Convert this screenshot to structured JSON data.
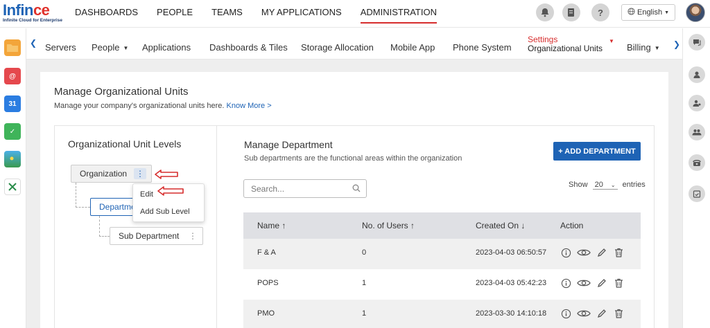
{
  "logo": {
    "brand_main": "Infin",
    "brand_accent": "ce",
    "tagline": "Infinite Cloud for Enterprise"
  },
  "main_nav": [
    "DASHBOARDS",
    "PEOPLE",
    "TEAMS",
    "MY APPLICATIONS",
    "ADMINISTRATION"
  ],
  "main_nav_active": "ADMINISTRATION",
  "header": {
    "language": "English",
    "help_symbol": "?"
  },
  "sub_nav": {
    "items": [
      "Servers",
      "People",
      "Applications",
      "Dashboards & Tiles",
      "Storage Allocation",
      "Mobile App",
      "Phone System"
    ],
    "settings_label": "Settings",
    "settings_value": "Organizational Units",
    "billing": "Billing"
  },
  "calendar_day": "31",
  "page": {
    "title": "Manage Organizational Units",
    "subtitle": "Manage your company's organizational units here.",
    "know_more": "Know More >"
  },
  "levels": {
    "title": "Organizational Unit Levels",
    "nodes": [
      "Organization",
      "Department",
      "Sub Department"
    ],
    "menu": [
      "Edit",
      "Add Sub Level"
    ]
  },
  "departments": {
    "title": "Manage Department",
    "subtitle": "Sub departments are the functional areas within the organization",
    "add_button": "+ ADD DEPARTMENT",
    "search_placeholder": "Search...",
    "show_label": "Show",
    "entries_value": "20",
    "entries_label": "entries",
    "columns": [
      "Name ↑",
      "No. of Users ↑",
      "Created On ↓",
      "Action"
    ],
    "rows": [
      {
        "name": "F & A",
        "users": "0",
        "created": "2023-04-03 06:50:57"
      },
      {
        "name": "POPS",
        "users": "1",
        "created": "2023-04-03 05:42:23"
      },
      {
        "name": "PMO",
        "users": "1",
        "created": "2023-03-30 14:10:18"
      }
    ]
  },
  "colors": {
    "brand_blue": "#1e63b5",
    "accent_red": "#d62d2d",
    "header_bg": "#dfe0e4"
  }
}
